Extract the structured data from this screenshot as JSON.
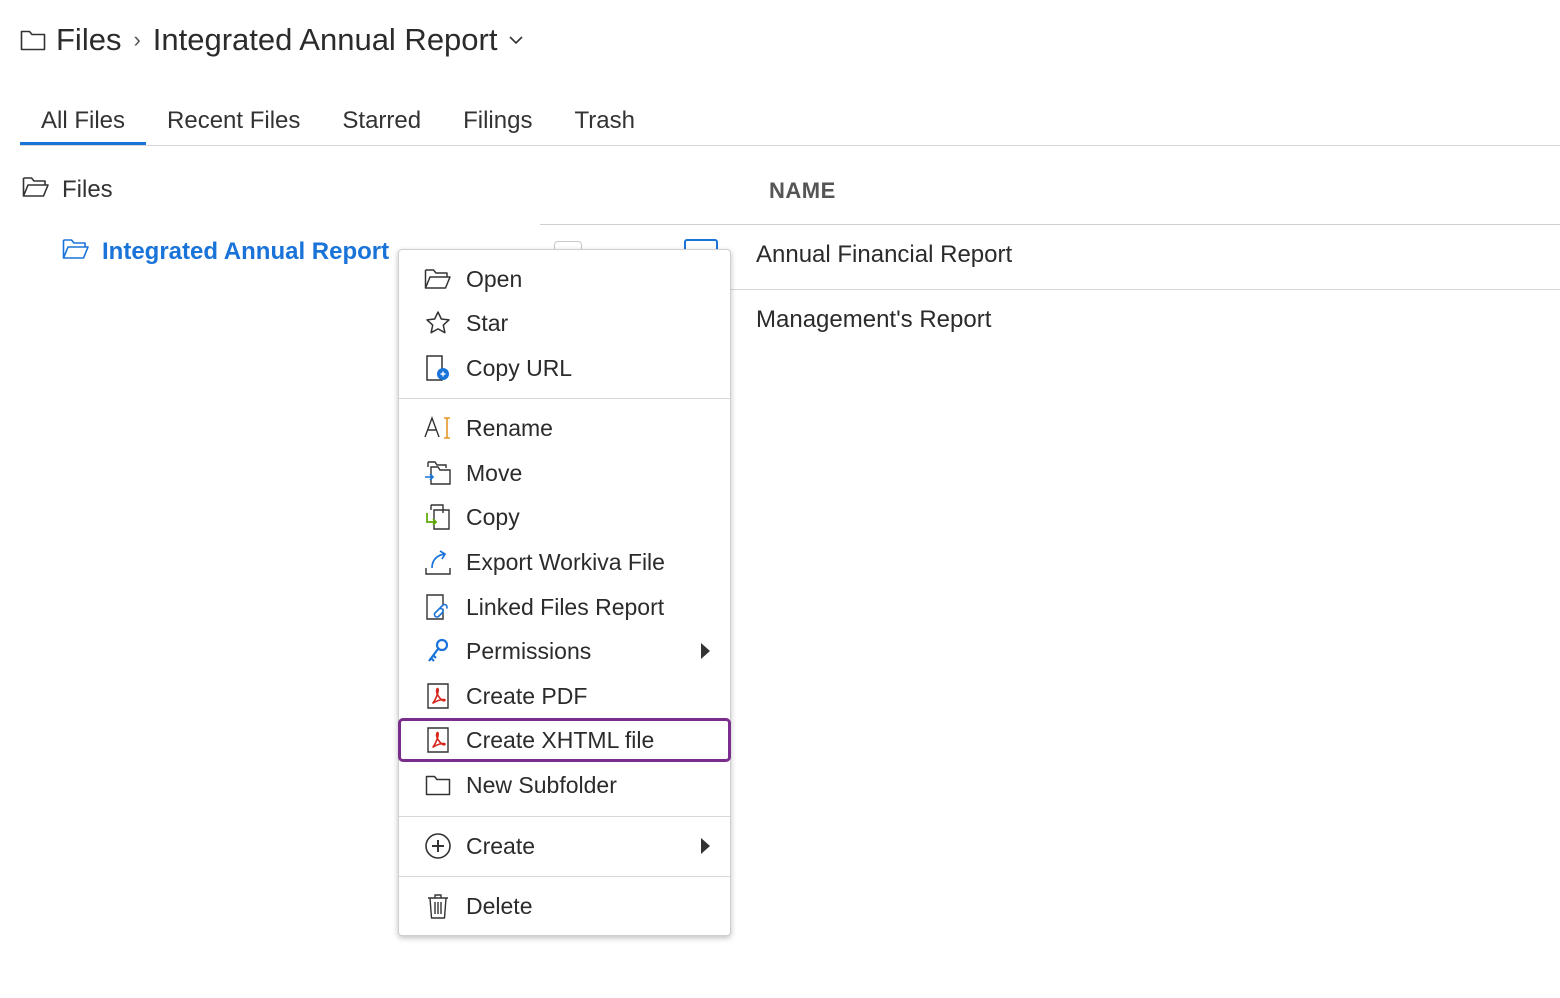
{
  "breadcrumb": {
    "root_label": "Files",
    "separator": "›",
    "current_label": "Integrated Annual Report"
  },
  "tabs": [
    {
      "label": "All Files",
      "active": true
    },
    {
      "label": "Recent Files",
      "active": false
    },
    {
      "label": "Starred",
      "active": false
    },
    {
      "label": "Filings",
      "active": false
    },
    {
      "label": "Trash",
      "active": false
    }
  ],
  "tree": {
    "root_label": "Files",
    "child_label": "Integrated Annual Report"
  },
  "list": {
    "name_header": "NAME",
    "rows": [
      {
        "name": "Annual Financial Report"
      },
      {
        "name": "Management's Report"
      }
    ]
  },
  "context_menu": {
    "groups": [
      [
        {
          "label": "Open",
          "icon": "folder-open-icon"
        },
        {
          "label": "Star",
          "icon": "star-icon"
        },
        {
          "label": "Copy URL",
          "icon": "copy-url-icon"
        }
      ],
      [
        {
          "label": "Rename",
          "icon": "rename-icon"
        },
        {
          "label": "Move",
          "icon": "move-icon"
        },
        {
          "label": "Copy",
          "icon": "copy-icon"
        },
        {
          "label": "Export Workiva File",
          "icon": "export-icon"
        },
        {
          "label": "Linked Files Report",
          "icon": "linked-files-icon"
        },
        {
          "label": "Permissions",
          "icon": "permissions-key-icon",
          "submenu": true
        },
        {
          "label": "Create PDF",
          "icon": "pdf-icon"
        },
        {
          "label": "Create XHTML file",
          "icon": "pdf-icon",
          "focused": true
        },
        {
          "label": "New Subfolder",
          "icon": "folder-icon"
        }
      ],
      [
        {
          "label": "Create",
          "icon": "plus-circle-icon",
          "submenu": true
        }
      ],
      [
        {
          "label": "Delete",
          "icon": "trash-icon"
        }
      ]
    ]
  },
  "colors": {
    "accent": "#1a73d9",
    "focus_outline": "#7b2d8e",
    "pdf_red": "#d9261c",
    "copy_green": "#5aa800",
    "rename_orange": "#e8952b"
  }
}
